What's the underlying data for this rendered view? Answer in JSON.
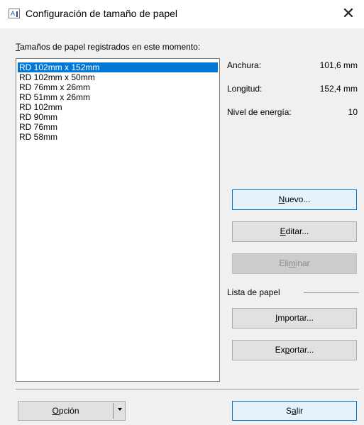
{
  "window": {
    "title": "Configuración de tamaño de papel",
    "icon_letter": "A",
    "close_glyph": "✕"
  },
  "list": {
    "label_first": "T",
    "label_rest": "amaños de papel registrados en este momento:",
    "items": [
      "RD 102mm x 152mm",
      "RD 102mm x 50mm",
      "RD 76mm x 26mm",
      "RD 51mm x 26mm",
      "RD 102mm",
      "RD 90mm",
      "RD 76mm",
      "RD 58mm"
    ],
    "selected_index": 0
  },
  "properties": {
    "width_label": "Anchura:",
    "width_value": "101,6 mm",
    "length_label": "Longitud:",
    "length_value": "152,4 mm",
    "energy_label": "Nivel de energía:",
    "energy_value": "10"
  },
  "buttons": {
    "new": {
      "pre": "",
      "u": "N",
      "post": "uevo..."
    },
    "edit": {
      "pre": "",
      "u": "E",
      "post": "ditar..."
    },
    "delete": {
      "pre": "Eli",
      "u": "m",
      "post": "inar"
    },
    "import": {
      "pre": "",
      "u": "I",
      "post": "mportar..."
    },
    "export": {
      "pre": "Ex",
      "u": "p",
      "post": "ortar..."
    },
    "option": {
      "pre": "",
      "u": "O",
      "post": "pción"
    },
    "exit": {
      "pre": "S",
      "u": "a",
      "post": "lir"
    }
  },
  "paper_list_group": "Lista de papel",
  "colors": {
    "selection": "#0078d7",
    "default_button_border": "#0078d7",
    "default_button_fill": "#e5f1fb",
    "dialog_bg": "#f0f0f0"
  },
  "icons": [
    "app-icon",
    "close-icon",
    "dropdown-arrow-icon"
  ]
}
